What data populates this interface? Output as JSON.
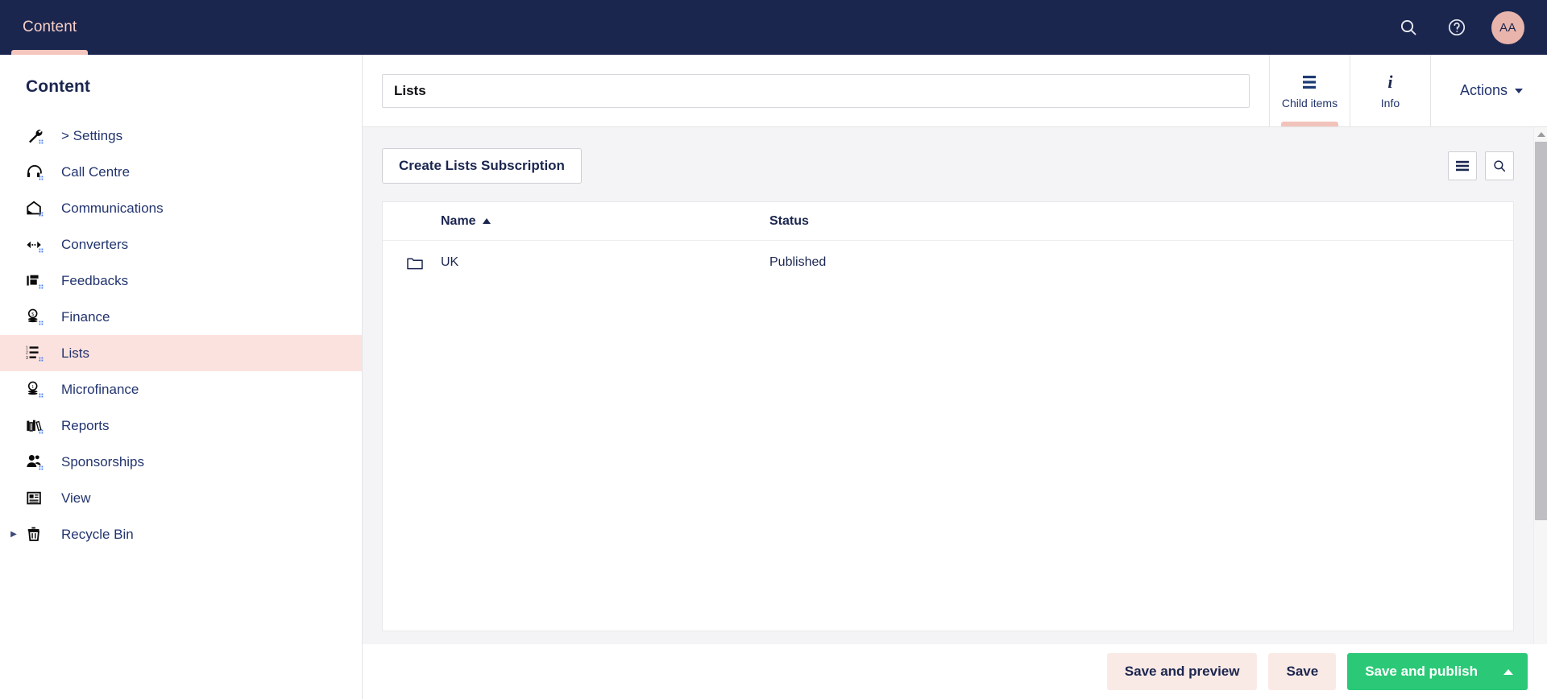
{
  "topbar": {
    "tabs": [
      {
        "label": "Content",
        "active": true
      }
    ],
    "search_icon": "search-icon",
    "help_icon": "help-circle-icon",
    "avatar_initials": "AA"
  },
  "sidebar": {
    "title": "Content",
    "items": [
      {
        "label": "> Settings",
        "icon": "wrench-icon",
        "active": false,
        "expandable": false
      },
      {
        "label": "Call Centre",
        "icon": "headset-icon",
        "active": false,
        "expandable": false
      },
      {
        "label": "Communications",
        "icon": "envelope-open-icon",
        "active": false,
        "expandable": false
      },
      {
        "label": "Converters",
        "icon": "code-arrows-icon",
        "active": false,
        "expandable": false
      },
      {
        "label": "Feedbacks",
        "icon": "feedback-icon",
        "active": false,
        "expandable": false
      },
      {
        "label": "Finance",
        "icon": "coin-stack-icon",
        "active": false,
        "expandable": false
      },
      {
        "label": "Lists",
        "icon": "ordered-list-icon",
        "active": true,
        "expandable": false
      },
      {
        "label": "Microfinance",
        "icon": "coin-stack-icon",
        "active": false,
        "expandable": false
      },
      {
        "label": "Reports",
        "icon": "books-icon",
        "active": false,
        "expandable": false
      },
      {
        "label": "Sponsorships",
        "icon": "users-icon",
        "active": false,
        "expandable": false
      },
      {
        "label": "View",
        "icon": "article-icon",
        "active": false,
        "expandable": false
      },
      {
        "label": "Recycle Bin",
        "icon": "trash-icon",
        "active": false,
        "expandable": true
      }
    ]
  },
  "editor": {
    "title_value": "Lists",
    "title_placeholder": "Enter a name...",
    "tabs": [
      {
        "label": "Child items",
        "icon": "list-lines-icon",
        "active": true
      },
      {
        "label": "Info",
        "icon": "info-italic-icon",
        "active": false
      }
    ],
    "actions_label": "Actions"
  },
  "toolbar": {
    "create_label": "Create Lists Subscription",
    "list_view_icon": "list-view-icon",
    "search_icon": "search-icon"
  },
  "table": {
    "columns": [
      {
        "key": "name",
        "label": "Name",
        "sort": "asc"
      },
      {
        "key": "status",
        "label": "Status",
        "sort": null
      }
    ],
    "rows": [
      {
        "icon": "folder-icon",
        "name": "UK",
        "status": "Published"
      }
    ]
  },
  "footer": {
    "save_and_preview_label": "Save and preview",
    "save_label": "Save",
    "save_and_publish_label": "Save and publish",
    "publish_caret_icon": "caret-up-icon"
  },
  "colors": {
    "navbar_bg": "#1b264f",
    "accent_pink": "#f5c6bd",
    "active_row_bg": "#fce2de",
    "publish_green": "#2bc977",
    "text_navy": "#1b264f",
    "link_navy": "#22346e",
    "panel_bg": "#f4f4f6",
    "avatar_bg": "#e8b4ab"
  }
}
